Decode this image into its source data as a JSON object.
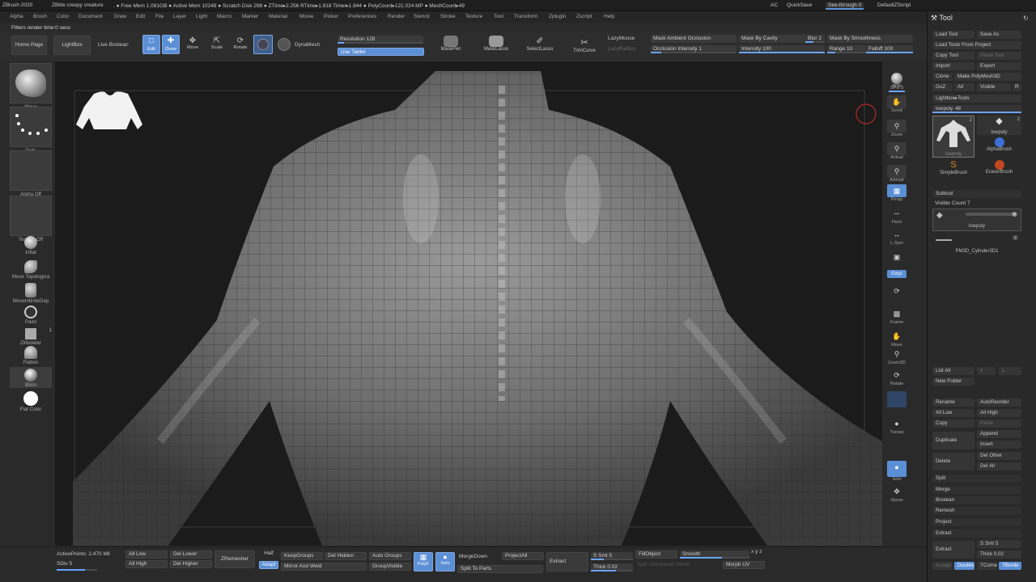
{
  "titlebar": {
    "app": "ZBrush 2020",
    "doc": "ZBtile creepy creature",
    "stats": ". ● Free Mem 1.081GB ● Active Mem 10248 ● Scratch Disk 298 ● ZTime▸2.256 RTime▸1.918 Timer▸1.844 ● PolyCount▸121.024 MP ● MeshCount▸49",
    "ac": "AC",
    "quicksave": "QuickSave",
    "seethrough": "See-through  0",
    "defaultzscript": "DefaultZScript"
  },
  "menu": [
    "Alpha",
    "Brush",
    "Color",
    "Document",
    "Draw",
    "Edit",
    "File",
    "Layer",
    "Light",
    "Macro",
    "Marker",
    "Material",
    "Movie",
    "Picker",
    "Preferences",
    "Render",
    "Stencil",
    "Stroke",
    "Texture",
    "Tool",
    "Transform",
    "Zplugin",
    "Zscript",
    "Help"
  ],
  "render_status": "Filters render time:0 secs",
  "topshelf": {
    "home": "Home Page",
    "lightbox": "LightBox",
    "liveboolean": "Live Boolean",
    "edit": "Edit",
    "draw": "Draw",
    "move": "Move",
    "scale": "Scale",
    "rotate": "Rotate",
    "dynamesh": "DynaMesh",
    "resolution": "Resolution 128",
    "usetablet": "Use Tablet",
    "maskpen": "MaskPen",
    "masklasso": "MaskLasso",
    "selectlasso": "SelectLasso",
    "trimcurve": "TrimCurve",
    "lazymouse": "LazyMouse",
    "lazyradius": "LazyRadius",
    "mask_ao": "Mask Ambient Occlusion",
    "occlusion": "Occlusion Intensity 1",
    "mask_cavity": "Mask By Cavity",
    "intensity": "Intensity 100",
    "blur": "Blur 2",
    "mask_smooth": "Mask By Smoothness",
    "range": "Range 10",
    "falloff": "Falloff 100"
  },
  "leftshelf": {
    "move": "Move",
    "dots": "Dots",
    "alpha": "Alpha Off",
    "texture": "Texture Off",
    "inflat": "Inflat",
    "move_topo": "Move Topologica",
    "move_infinite": "MoveInfiniteDep",
    "paint": "Paint",
    "zmodeler": "ZModeler",
    "zmodeler_badge": "1",
    "flatten": "Flatten",
    "blinn": "Blinn",
    "flatcolor": "Flat Color"
  },
  "rightshelf": {
    "bpr": "BPR",
    "spix": "SPix 3",
    "scroll": "Scroll",
    "zoom": "Zoom",
    "actual": "Actual",
    "aahalf": "AAHalf",
    "persp": "Persp",
    "floor": "Floor",
    "lsym": "L.Sym",
    "gxyz": "Gxyz",
    "frame": "Frame",
    "move": "Move",
    "zoom3d": "Zoom3D",
    "rotate": "Rotate",
    "transp": "Transp",
    "solo": "Solo",
    "xpose": "Xpose"
  },
  "toolpanel": {
    "title": "Tool",
    "load_tool": "Load Tool",
    "save_as": "Save As",
    "load_from_project": "Load Tools From Project",
    "copy_tool": "Copy Tool",
    "paste_tool": "Paste Tool",
    "import": "Import",
    "export": "Export",
    "clone": "Clone",
    "make_polymesh": "Make PolyMesh3D",
    "goz": "GoZ",
    "all": "All",
    "visible": "Visible",
    "r": "R",
    "lightbox_tools": "Lightbox▸Tools",
    "lowpoly_slider": "lowpoly. 48",
    "thumb1_name": "lowpoly",
    "thumb1_count": "2",
    "thumb2_name": "lowpoly",
    "thumb2_count": "2",
    "alphabrush": "AlphaBrush",
    "simplebrush": "SimpleBrush",
    "eraserbrush": "EraserBrush",
    "subtool": "Subtool",
    "visible_count": "Visible Count 7",
    "subtool1": "lowpoly",
    "subtool2": "PM3D_Cylinder3D1",
    "list_all": "List All",
    "new_folder": "New Folder",
    "rename": "Rename",
    "autoreorder": "AutoReorder",
    "all_low": "All Low",
    "all_high": "All High",
    "copy": "Copy",
    "paste": "Paste",
    "duplicate": "Duplicate",
    "append": "Append",
    "insert": "Insert",
    "delete": "Delete",
    "del_other": "Del Other",
    "del_all": "Del All",
    "split": "Split",
    "merge": "Merge",
    "boolean": "Boolean",
    "remesh": "Remesh",
    "project": "Project",
    "extract_header": "Extract",
    "extract": "Extract",
    "s_smt": "S Smt 5",
    "thick": "Thick 0.02",
    "accept": "Accept",
    "double": "Double",
    "tcorne": "TCorne",
    "tborde": "TBorde"
  },
  "bottom": {
    "active_points": "ActivePoints: 2.470 Mil",
    "sdiv": "SDiv 5",
    "all_low": "All Low",
    "all_high": "All High",
    "del_lower": "Del Lower",
    "del_higher": "Del Higher",
    "zremesher": "ZRemesher",
    "half": "Half",
    "adapt": "Adapt",
    "keepgroups": "KeepGroups",
    "mirror_weld": "Mirror And Weld",
    "del_hidden": "Del Hidden",
    "auto_groups": "Auto Groups",
    "groupvisible": "GroupVisible",
    "polyf": "PolyF",
    "solo": "Solo",
    "mergedown": "MergeDown",
    "split_to_parts": "Split To Parts",
    "projectall": "ProjectAll",
    "extract": "Extract",
    "s_smt": "S Smt 5",
    "thick": "Thick 0.02",
    "fillobject": "FillObject",
    "split_unmasked": "Split Unmasked Points",
    "smooth": "Smooth",
    "morph_uv": "Morph UV",
    "xyz": "x y z"
  }
}
